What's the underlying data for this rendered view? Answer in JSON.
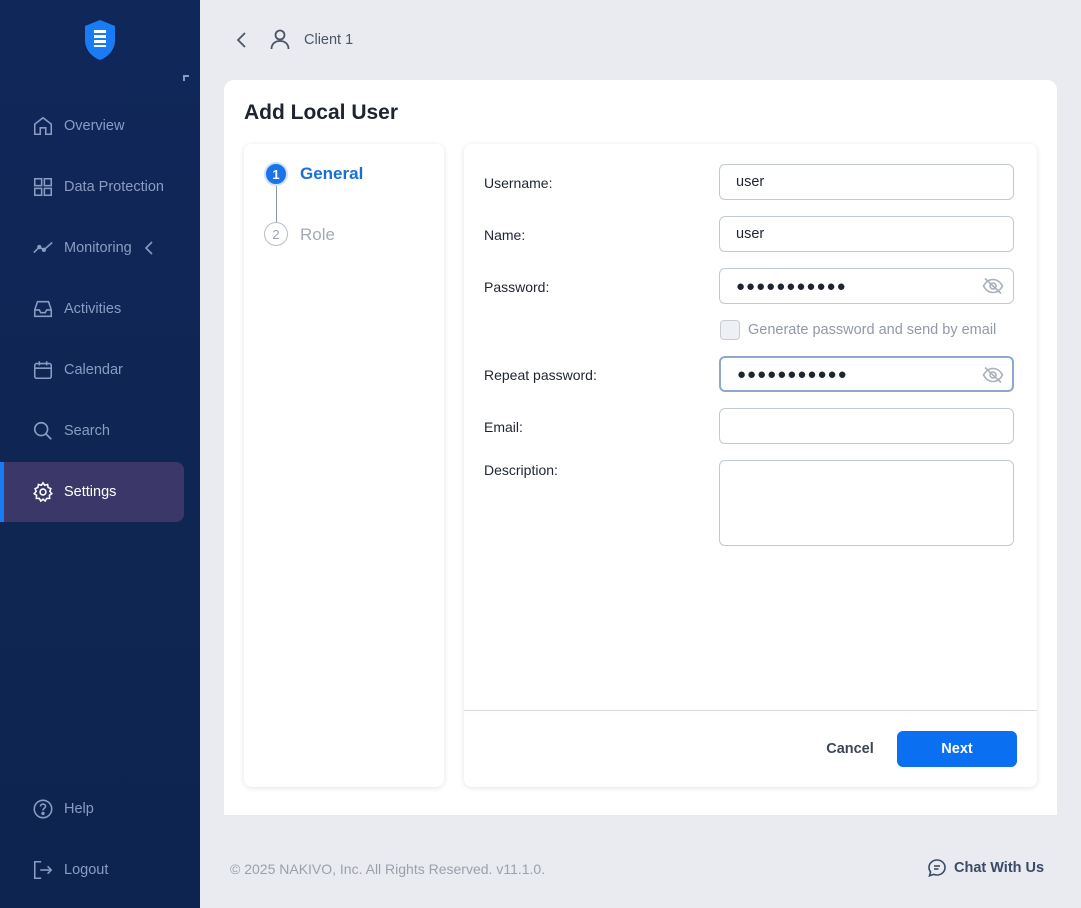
{
  "sidebar": {
    "items": [
      {
        "label": "Overview",
        "icon": "home-icon"
      },
      {
        "label": "Data Protection",
        "icon": "grid-icon"
      },
      {
        "label": "Monitoring",
        "icon": "trend-icon"
      },
      {
        "label": "Activities",
        "icon": "inbox-icon"
      },
      {
        "label": "Calendar",
        "icon": "calendar-icon"
      },
      {
        "label": "Search",
        "icon": "search-icon"
      },
      {
        "label": "Settings",
        "icon": "gear-icon",
        "active": true
      }
    ],
    "bottom": [
      {
        "label": "Help",
        "icon": "help-icon"
      },
      {
        "label": "Logout",
        "icon": "logout-icon"
      }
    ],
    "accent": "#1a7cf5"
  },
  "header": {
    "client_name": "Client 1"
  },
  "wizard": {
    "title": "Add Local User",
    "steps": [
      {
        "number": "1",
        "label": "General",
        "active": true
      },
      {
        "number": "2",
        "label": "Role",
        "active": false
      }
    ]
  },
  "form": {
    "username_label": "Username:",
    "username_value": "user",
    "name_label": "Name:",
    "name_value": "user",
    "password_label": "Password:",
    "password_value": "●●●●●●●●●●●",
    "generate_label": "Generate password and send by email",
    "repeat_label": "Repeat password:",
    "repeat_value": "●●●●●●●●●●●",
    "email_label": "Email:",
    "email_value": "",
    "description_label": "Description:",
    "description_value": ""
  },
  "actions": {
    "cancel_label": "Cancel",
    "next_label": "Next",
    "primary_color": "#0a6ff0"
  },
  "footer": {
    "copyright": "© 2025 NAKIVO, Inc. All Rights Reserved. v11.1.0.",
    "chat_label": "Chat With Us"
  }
}
